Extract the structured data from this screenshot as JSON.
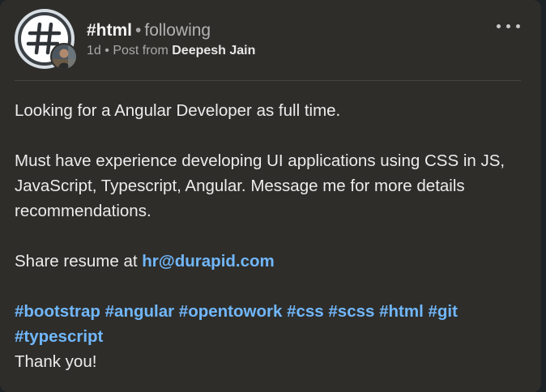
{
  "header": {
    "group_name": "#html",
    "separator": "•",
    "follow_status": "following",
    "time": "1d",
    "post_from_label": "Post from",
    "author": "Deepesh Jain",
    "avatar_icon": "hash-icon"
  },
  "post": {
    "line1": "Looking for a Angular Developer as full time.",
    "line2": "Must have experience developing UI applications using CSS in JS, JavaScript, Typescript, Angular. Message me for more details recommendations.",
    "share_prefix": "Share resume at",
    "email": "hr@durapid.com",
    "hashtags": [
      "#bootstrap",
      "#angular",
      "#opentowork",
      "#css",
      "#scss",
      "#html",
      "#git",
      "#typescript"
    ],
    "closing": "Thank you!"
  },
  "colors": {
    "card_bg": "#2e2d2a",
    "link": "#71b7fb",
    "text": "#ececec",
    "muted": "#a9a9a9"
  }
}
